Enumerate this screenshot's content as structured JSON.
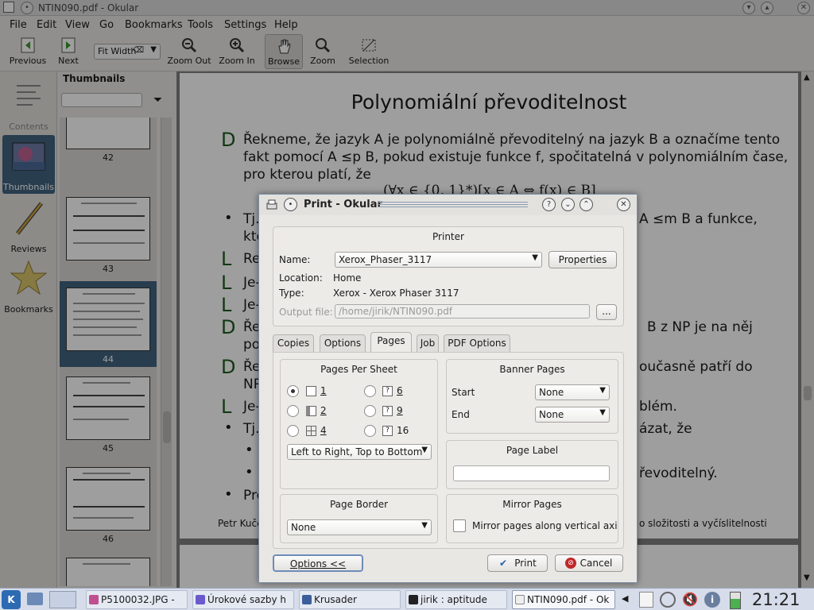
{
  "window": {
    "title": "NTIN090.pdf - Okular"
  },
  "menu": [
    "File",
    "Edit",
    "View",
    "Go",
    "Bookmarks",
    "Tools",
    "Settings",
    "Help"
  ],
  "toolbar": {
    "previous": "Previous",
    "next": "Next",
    "zoom_mode": "Fit Width",
    "zoom_out": "Zoom Out",
    "zoom_in": "Zoom In",
    "browse": "Browse",
    "zoom": "Zoom",
    "selection": "Selection"
  },
  "sidebar": {
    "items": [
      {
        "label": "Contents"
      },
      {
        "label": "Thumbnails"
      },
      {
        "label": "Reviews"
      },
      {
        "label": "Bookmarks"
      }
    ],
    "active": "Thumbnails"
  },
  "thumbnails": {
    "header": "Thumbnails",
    "pages": [
      "42",
      "43",
      "44",
      "45",
      "46"
    ],
    "selected": "44"
  },
  "document": {
    "title": "Polynomiální převoditelnost",
    "lines": [
      "Řekneme, že jazyk A je polynomiálně převoditelný na jazyk B a označíme tento",
      "fakt pomocí A ≤p B, pokud existuje funkce f, spočitatelná v polynomiálním čase,",
      "pro kterou platí, že",
      "(∀x ∈ {0, 1}*)[x ∈ A ⇔ f(x) ∈ B]",
      "Tj.",
      "A ≤m B a funkce,",
      "kte",
      "Re",
      "Je-",
      "Je-",
      "Ře",
      "B z NP je na něj",
      "pol",
      "Ře",
      "oučasně patří do",
      "NP",
      "Je-",
      "blém.",
      "Tj.",
      "ázat, že",
      "řevoditelný.",
      "Pro"
    ],
    "footer_left": "Petr Kuče",
    "footer_right": "o složitosti a vyčíslitelnosti"
  },
  "dialog": {
    "title": "Print - Okular",
    "printer_group": "Printer",
    "name_label": "Name:",
    "printer_name": "Xerox_Phaser_3117",
    "properties": "Properties",
    "location_label": "Location:",
    "location_value": "Home",
    "type_label": "Type:",
    "type_value": "Xerox - Xerox Phaser 3117",
    "output_label": "Output file:",
    "output_value": "/home/jirik/NTIN090.pdf",
    "browse_btn": "...",
    "tabs": [
      "Copies",
      "Options",
      "Pages",
      "Job",
      "PDF Options"
    ],
    "active_tab": "Pages",
    "pages_per_sheet": {
      "title": "Pages Per Sheet",
      "options": [
        "1",
        "2",
        "4",
        "6",
        "9",
        "16"
      ],
      "selected": "1",
      "order": "Left to Right, Top to Bottom"
    },
    "banner": {
      "title": "Banner Pages",
      "start_label": "Start",
      "start_value": "None",
      "end_label": "End",
      "end_value": "None"
    },
    "page_label": {
      "title": "Page Label",
      "value": ""
    },
    "page_border": {
      "title": "Page Border",
      "value": "None"
    },
    "mirror": {
      "title": "Mirror Pages",
      "checkbox_label": "Mirror pages along vertical axis",
      "checked": false
    },
    "options_btn": "Options <<",
    "print_btn": "Print",
    "cancel_btn": "Cancel"
  },
  "taskbar": {
    "tasks": [
      "P5100032.JPG - ",
      "Úrokové sazby h",
      "Krusader",
      "jirik : aptitude",
      "NTIN090.pdf - Ok"
    ],
    "active": "NTIN090.pdf - Ok",
    "clock": "21:21"
  },
  "colors": {
    "accent": "#41627e",
    "doc_link": "#2a2a8a",
    "slide_letter": "#1d5a1d"
  }
}
